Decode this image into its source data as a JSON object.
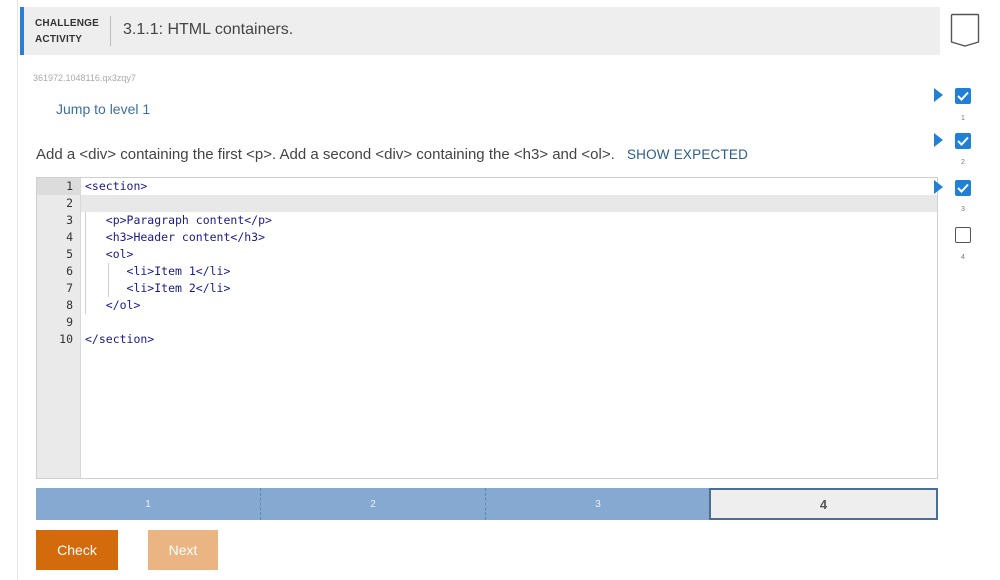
{
  "header": {
    "activity_label": "CHALLENGE ACTIVITY",
    "title": "3.1.1: HTML containers."
  },
  "activity_id": "361972.1048116.qx3zqy7",
  "jump_link": "Jump to level 1",
  "instructions": {
    "text": "Add a <div> containing the first <p>. Add a second <div> containing the <h3> and <ol>.",
    "show_expected": "SHOW EXPECTED"
  },
  "editor": {
    "line_numbers": [
      "1",
      "2",
      "3",
      "4",
      "5",
      "6",
      "7",
      "8",
      "9",
      "10"
    ],
    "lines": [
      "<section>",
      "",
      "   <p>Paragraph content</p>",
      "   <h3>Header content</h3>",
      "   <ol>",
      "      <li>Item 1</li>",
      "      <li>Item 2</li>",
      "   </ol>",
      "",
      "</section>"
    ]
  },
  "progress": {
    "levels": [
      {
        "label": "1",
        "state": "complete"
      },
      {
        "label": "2",
        "state": "complete"
      },
      {
        "label": "3",
        "state": "complete"
      },
      {
        "label": "4",
        "state": "current"
      }
    ]
  },
  "buttons": {
    "check": "Check",
    "next": "Next"
  },
  "level_sidebar": [
    {
      "label": "1",
      "done": true
    },
    {
      "label": "2",
      "done": true
    },
    {
      "label": "3",
      "done": true
    },
    {
      "label": "4",
      "done": false
    }
  ],
  "colors": {
    "accent": "#2a7fd4",
    "check_button": "#d36b0c",
    "next_button_disabled": "#eab483",
    "progress_complete": "#85a9d0",
    "progress_current_border": "#4d6e93",
    "checkbox_done": "#1f80d6"
  }
}
